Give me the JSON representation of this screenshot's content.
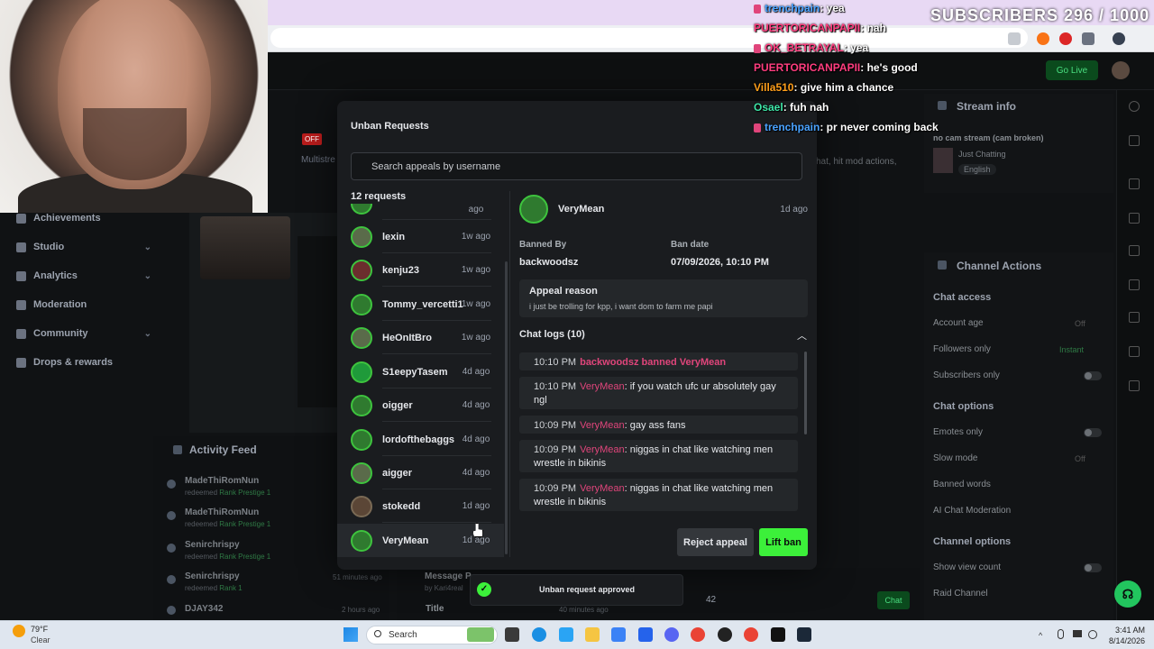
{
  "browser": {
    "chat_input_placeholder": ""
  },
  "sidebar": {
    "items": [
      {
        "label": "Achievements",
        "chev": ""
      },
      {
        "label": "Studio",
        "chev": "⌄"
      },
      {
        "label": "Analytics",
        "chev": "⌄"
      },
      {
        "label": "Moderation",
        "chev": ""
      },
      {
        "label": "Community",
        "chev": "⌄"
      },
      {
        "label": "Drops & rewards",
        "chev": ""
      }
    ],
    "off_badge": "OFF",
    "multistream_label": "Multistre"
  },
  "activity": {
    "title": "Activity Feed",
    "rows": [
      {
        "name": "MadeThiRomNun",
        "prefix": "redeemed",
        "reward": "Rank Prestige 1",
        "time": ""
      },
      {
        "name": "MadeThiRomNun",
        "prefix": "redeemed",
        "reward": "Rank Prestige 1",
        "time": ""
      },
      {
        "name": "Senirchrispy",
        "prefix": "redeemed",
        "reward": "Rank Prestige 1",
        "time": ""
      },
      {
        "name": "Senirchrispy",
        "prefix": "redeemed",
        "reward": "Rank 1",
        "time": "51 minutes ago"
      },
      {
        "name": "DJAY342",
        "prefix": "",
        "reward": "",
        "time": "2 hours ago"
      }
    ]
  },
  "center_underlay": {
    "message_label": "Message P",
    "message_by": "by Kari4real",
    "title_label": "Title",
    "time": "40 minutes ago",
    "viewer_count": "42",
    "chat_button": "Chat"
  },
  "topbar": {
    "go_live": "Go Live"
  },
  "stream_info": {
    "title": "Stream info",
    "stream_title": "no cam stream (cam broken)",
    "category": "Just Chatting",
    "language": "English"
  },
  "channel_actions": {
    "title": "Channel Actions",
    "chat_access_head": "Chat access",
    "account_age": "Account age",
    "account_age_val": "Off",
    "followers_only": "Followers only",
    "followers_only_val": "Instant",
    "subscribers_only": "Subscribers only",
    "chat_options_head": "Chat options",
    "emotes_only": "Emotes only",
    "slow_mode": "Slow mode",
    "slow_mode_val": "Off",
    "banned_words": "Banned words",
    "ai_moderation": "AI Chat Moderation",
    "channel_options_head": "Channel options",
    "show_view_count": "Show view count",
    "raid_channel": "Raid Channel",
    "partial_text": "hat, hit mod actions,"
  },
  "modal": {
    "title": "Unban Requests",
    "search_placeholder": "Search appeals by username",
    "count": "12 requests",
    "requests": [
      {
        "name": "",
        "time": "ago"
      },
      {
        "name": "lexin",
        "time": "1w ago"
      },
      {
        "name": "kenju23",
        "time": "1w ago"
      },
      {
        "name": "Tommy_vercetti1",
        "time": "1w ago"
      },
      {
        "name": "HeOnItBro",
        "time": "1w ago"
      },
      {
        "name": "S1eepyTasem",
        "time": "4d ago"
      },
      {
        "name": "oigger",
        "time": "4d ago"
      },
      {
        "name": "lordofthebaggs",
        "time": "4d ago"
      },
      {
        "name": "aigger",
        "time": "4d ago"
      },
      {
        "name": "stokedd",
        "time": "1d ago"
      },
      {
        "name": "VeryMean",
        "time": "1d ago"
      }
    ],
    "detail": {
      "name": "VeryMean",
      "time": "1d ago",
      "banned_by_label": "Banned By",
      "banned_by": "backwoodsz",
      "ban_date_label": "Ban date",
      "ban_date": "07/09/2026, 10:10 PM",
      "appeal_label": "Appeal reason",
      "appeal_text": "i just be trolling for kpp, i want dom to farm me papi",
      "logs_label": "Chat logs (10)",
      "logs": [
        {
          "time": "10:10 PM",
          "user": "",
          "msg": "backwoodsz banned VeryMean"
        },
        {
          "time": "10:10 PM",
          "user": "VeryMean",
          "msg": ": if you watch ufc ur absolutely gay ngl"
        },
        {
          "time": "10:09 PM",
          "user": "VeryMean",
          "msg": ": gay ass fans"
        },
        {
          "time": "10:09 PM",
          "user": "VeryMean",
          "msg": ": niggas in chat like watching men wrestle in bikinis"
        },
        {
          "time": "10:09 PM",
          "user": "VeryMean",
          "msg": ": niggas in chat like watching men wrestle in bikinis"
        }
      ],
      "reject_label": "Reject appeal",
      "lift_label": "Lift ban"
    }
  },
  "toast": {
    "text": "Unban request approved"
  },
  "overlay": {
    "subs": "SUBSCRIBERS 296 / 1000",
    "chat": [
      {
        "user": "trenchpain",
        "msg": ": yea",
        "color": "#4aa3ff",
        "badge": true
      },
      {
        "user": "PUERTORICANPAPII",
        "msg": ": nah",
        "color": "#ff3d7f",
        "badge": false
      },
      {
        "user": "OK_BETRAYAL",
        "msg": ": yea",
        "color": "#ff3d7f",
        "badge": true
      },
      {
        "user": "PUERTORICANPAPII",
        "msg": ": he's good",
        "color": "#ff3d7f",
        "badge": false
      },
      {
        "user": "Villa510",
        "msg": ": give him a chance",
        "color": "#ff9f1a",
        "badge": false
      },
      {
        "user": "Osael",
        "msg": ": fuh nah",
        "color": "#3ee6a8",
        "badge": false
      },
      {
        "user": "trenchpain",
        "msg": ": pr never coming back",
        "color": "#4aa3ff",
        "badge": true
      }
    ]
  },
  "taskbar": {
    "temp": "79°F",
    "condition": "Clear",
    "search_label": "Search",
    "time": "3:41 AM",
    "date": "8/14/2026"
  },
  "colors": {
    "accent_green": "#3cf03a",
    "username_pink": "#e0457b"
  }
}
